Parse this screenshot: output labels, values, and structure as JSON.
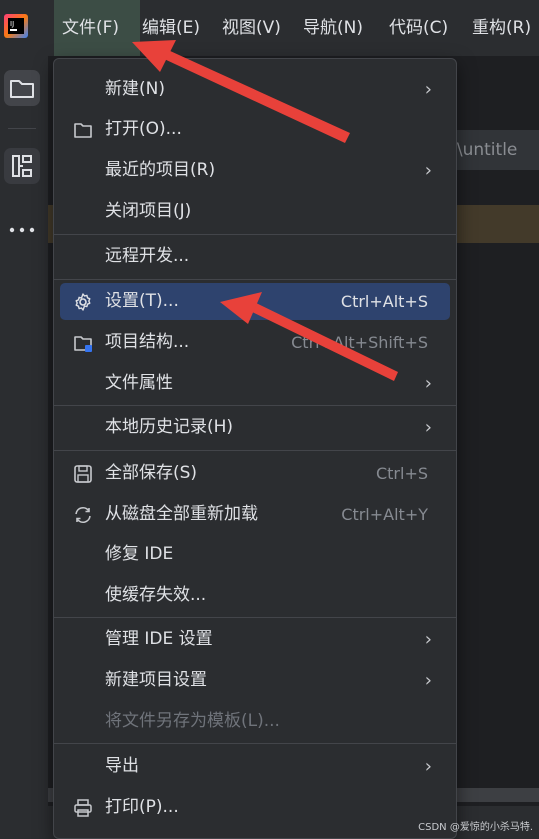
{
  "menubar": {
    "items": [
      {
        "label": "文件(F)"
      },
      {
        "label": "编辑(E)"
      },
      {
        "label": "视图(V)"
      },
      {
        "label": "导航(N)"
      },
      {
        "label": "代码(C)"
      },
      {
        "label": "重构(R)"
      }
    ]
  },
  "editor": {
    "path_fragment": "s\\untitle"
  },
  "file_menu": {
    "new": "新建(N)",
    "open": "打开(O)...",
    "recent": "最近的项目(R)",
    "close": "关闭项目(J)",
    "remote": "远程开发...",
    "settings": "设置(T)...",
    "settings_shortcut": "Ctrl+Alt+S",
    "structure": "项目结构...",
    "structure_shortcut": "Ctrl+Alt+Shift+S",
    "file_props": "文件属性",
    "local_history": "本地历史记录(H)",
    "save_all": "全部保存(S)",
    "save_all_shortcut": "Ctrl+S",
    "reload": "从磁盘全部重新加载",
    "reload_shortcut": "Ctrl+Alt+Y",
    "repair": "修复 IDE",
    "invalidate": "使缓存失效...",
    "manage_ide": "管理 IDE 设置",
    "new_project_settings": "新建项目设置",
    "save_as_template": "将文件另存为模板(L)...",
    "export": "导出",
    "print": "打印(P)..."
  },
  "watermark": "CSDN @爱惊的小杀马特.",
  "colors": {
    "accent_selected": "#2e436e",
    "annotation_arrow": "#e8413a"
  }
}
